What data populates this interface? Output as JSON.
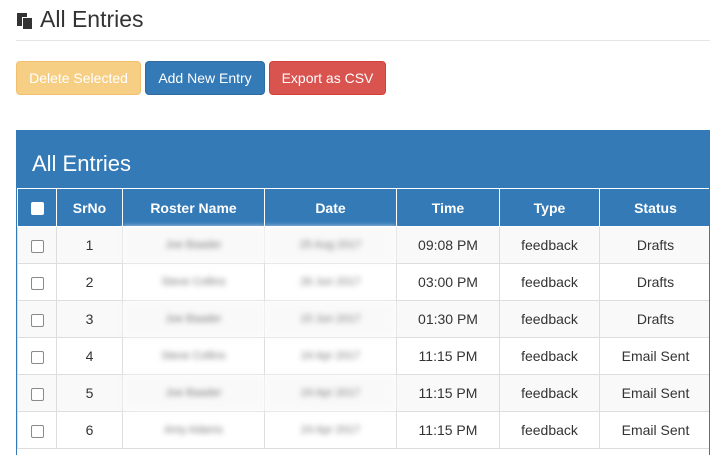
{
  "header": {
    "title": "All Entries"
  },
  "toolbar": {
    "delete_label": "Delete Selected",
    "add_label": "Add New Entry",
    "export_label": "Export as CSV"
  },
  "panel": {
    "title": "All Entries"
  },
  "table": {
    "columns": [
      "SrNo",
      "Roster Name",
      "Date",
      "Time",
      "Type",
      "Status"
    ],
    "rows": [
      {
        "srno": "1",
        "roster": "Joe Baader",
        "date": "25 Aug 2017",
        "time": "09:08 PM",
        "type": "feedback",
        "status": "Drafts"
      },
      {
        "srno": "2",
        "roster": "Steve Collins",
        "date": "26 Jun 2017",
        "time": "03:00 PM",
        "type": "feedback",
        "status": "Drafts"
      },
      {
        "srno": "3",
        "roster": "Joe Baader",
        "date": "15 Jun 2017",
        "time": "01:30 PM",
        "type": "feedback",
        "status": "Drafts"
      },
      {
        "srno": "4",
        "roster": "Steve Collins",
        "date": "24 Apr 2017",
        "time": "11:15 PM",
        "type": "feedback",
        "status": "Email Sent"
      },
      {
        "srno": "5",
        "roster": "Joe Baader",
        "date": "24 Apr 2017",
        "time": "11:15 PM",
        "type": "feedback",
        "status": "Email Sent"
      },
      {
        "srno": "6",
        "roster": "Amy Adams",
        "date": "24 Apr 2017",
        "time": "11:15 PM",
        "type": "feedback",
        "status": "Email Sent"
      }
    ]
  },
  "colors": {
    "primary": "#337ab7",
    "warning": "#f6cf85",
    "danger": "#d9534f"
  },
  "icons": {
    "page": "copy-icon"
  }
}
